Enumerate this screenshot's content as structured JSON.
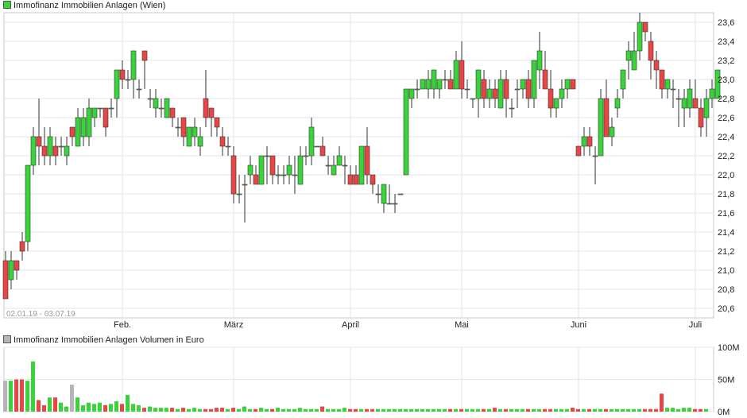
{
  "price_legend": "Immofinanz Immobilien Anlagen (Wien)",
  "volume_legend": "Immofinanz Immobilien Anlagen Volumen in Euro",
  "date_range": "02.01.19 - 03.07.19",
  "colors": {
    "up": "#39d439",
    "down": "#e84545",
    "neutral": "#b5b5b5",
    "grid": "#e6e6e6",
    "frame": "#c8c8c8"
  },
  "chart_data": [
    {
      "type": "candlestick",
      "title": "Immofinanz Immobilien Anlagen (Wien)",
      "ylim": [
        20.5,
        23.7
      ],
      "yticks": [
        "20,6",
        "20,8",
        "21,0",
        "21,2",
        "21,4",
        "21,6",
        "21,8",
        "22,0",
        "22,2",
        "22,4",
        "22,6",
        "22,8",
        "23,0",
        "23,2",
        "23,4",
        "23,6"
      ],
      "xticks": [
        {
          "label": "Feb.",
          "index": 21
        },
        {
          "label": "März",
          "index": 41
        },
        {
          "label": "April",
          "index": 62
        },
        {
          "label": "Mai",
          "index": 82
        },
        {
          "label": "Juni",
          "index": 103
        },
        {
          "label": "Juli",
          "index": 124
        }
      ],
      "candles": [
        [
          21.1,
          20.7,
          21.2,
          20.7
        ],
        [
          20.9,
          21.1,
          21.2,
          20.8
        ],
        [
          21.1,
          21.0,
          21.1,
          20.9
        ],
        [
          21.3,
          21.2,
          21.4,
          21.1
        ],
        [
          21.3,
          22.1,
          22.1,
          21.2
        ],
        [
          22.1,
          22.4,
          22.5,
          22.0
        ],
        [
          22.4,
          22.3,
          22.8,
          22.1
        ],
        [
          22.3,
          22.2,
          22.5,
          22.1
        ],
        [
          22.2,
          22.4,
          22.5,
          22.1
        ],
        [
          22.3,
          22.2,
          22.4,
          22.1
        ],
        [
          22.3,
          22.3,
          22.4,
          22.2
        ],
        [
          22.2,
          22.3,
          22.4,
          22.1
        ],
        [
          22.5,
          22.4,
          22.5,
          22.3
        ],
        [
          22.3,
          22.6,
          22.7,
          22.3
        ],
        [
          22.4,
          22.6,
          22.7,
          22.3
        ],
        [
          22.4,
          22.7,
          22.8,
          22.3
        ],
        [
          22.6,
          22.7,
          22.7,
          22.5
        ],
        [
          22.7,
          22.7,
          22.7,
          22.6
        ],
        [
          22.7,
          22.5,
          22.7,
          22.4
        ],
        [
          22.7,
          22.7,
          22.8,
          22.6
        ],
        [
          22.8,
          23.1,
          23.1,
          22.6
        ],
        [
          23.1,
          23.0,
          23.2,
          22.9
        ],
        [
          23.0,
          23.0,
          23.1,
          22.9
        ],
        [
          23.0,
          23.3,
          23.3,
          22.8
        ],
        [
          22.9,
          22.9,
          23.0,
          22.8
        ],
        [
          23.3,
          23.2,
          23.3,
          22.9
        ],
        [
          22.8,
          22.8,
          22.9,
          22.7
        ],
        [
          22.7,
          22.8,
          22.9,
          22.6
        ],
        [
          22.7,
          22.7,
          22.8,
          22.6
        ],
        [
          22.6,
          22.8,
          22.8,
          22.6
        ],
        [
          22.7,
          22.6,
          22.7,
          22.5
        ],
        [
          22.5,
          22.5,
          22.6,
          22.4
        ],
        [
          22.6,
          22.4,
          22.6,
          22.3
        ],
        [
          22.3,
          22.5,
          22.5,
          22.3
        ],
        [
          22.4,
          22.5,
          22.6,
          22.3
        ],
        [
          22.3,
          22.4,
          22.5,
          22.2
        ],
        [
          22.8,
          22.6,
          23.1,
          22.5
        ],
        [
          22.7,
          22.6,
          22.7,
          22.4
        ],
        [
          22.6,
          22.5,
          22.6,
          22.4
        ],
        [
          22.4,
          22.3,
          22.5,
          22.2
        ],
        [
          22.3,
          22.3,
          22.4,
          22.2
        ],
        [
          22.2,
          21.8,
          22.3,
          21.7
        ],
        [
          21.8,
          21.8,
          22.0,
          21.7
        ],
        [
          21.9,
          21.9,
          22.0,
          21.5
        ],
        [
          22.0,
          22.1,
          22.2,
          21.9
        ],
        [
          22.0,
          21.9,
          22.1,
          21.9
        ],
        [
          21.9,
          22.2,
          22.2,
          21.9
        ],
        [
          22.2,
          22.2,
          22.3,
          21.9
        ],
        [
          22.2,
          22.0,
          22.2,
          21.9
        ],
        [
          22.0,
          22.0,
          22.1,
          21.9
        ],
        [
          22.0,
          22.0,
          22.1,
          21.9
        ],
        [
          22.0,
          22.1,
          22.2,
          21.9
        ],
        [
          22.0,
          22.0,
          22.2,
          21.8
        ],
        [
          21.9,
          22.2,
          22.3,
          21.9
        ],
        [
          22.2,
          22.2,
          22.3,
          22.1
        ],
        [
          22.2,
          22.5,
          22.6,
          22.1
        ],
        [
          22.3,
          22.3,
          22.3,
          22.3
        ],
        [
          22.3,
          22.2,
          22.4,
          22.2
        ],
        [
          22.1,
          22.1,
          22.2,
          22.0
        ],
        [
          22.0,
          22.1,
          22.2,
          22.0
        ],
        [
          22.1,
          22.2,
          22.3,
          22.1
        ],
        [
          22.1,
          22.1,
          22.2,
          21.9
        ],
        [
          22.0,
          21.9,
          22.1,
          21.9
        ],
        [
          22.0,
          21.9,
          22.1,
          21.9
        ],
        [
          21.9,
          22.3,
          22.3,
          21.9
        ],
        [
          22.3,
          22.0,
          22.5,
          21.9
        ],
        [
          22.0,
          21.9,
          22.0,
          21.8
        ],
        [
          21.8,
          21.8,
          21.9,
          21.7
        ],
        [
          21.7,
          21.9,
          21.9,
          21.6
        ],
        [
          21.7,
          21.7,
          21.9,
          21.7
        ],
        [
          21.7,
          21.7,
          21.8,
          21.6
        ],
        [
          21.8,
          21.8,
          21.8,
          21.8
        ],
        [
          22.0,
          22.9,
          22.9,
          22.0
        ],
        [
          22.8,
          22.9,
          22.9,
          22.7
        ],
        [
          22.9,
          22.9,
          23.0,
          22.8
        ],
        [
          22.9,
          23.0,
          23.0,
          22.9
        ],
        [
          22.9,
          23.0,
          23.1,
          22.8
        ],
        [
          22.9,
          23.1,
          23.1,
          22.8
        ],
        [
          22.9,
          23.0,
          23.0,
          22.8
        ],
        [
          23.0,
          23.0,
          23.1,
          22.9
        ],
        [
          23.0,
          22.9,
          23.1,
          22.9
        ],
        [
          22.9,
          23.2,
          23.3,
          22.9
        ],
        [
          23.2,
          22.9,
          23.4,
          22.8
        ],
        [
          22.9,
          22.9,
          23.0,
          22.8
        ],
        [
          22.8,
          22.8,
          22.8,
          22.7
        ],
        [
          22.8,
          23.1,
          23.1,
          22.6
        ],
        [
          23.0,
          22.8,
          23.1,
          22.7
        ],
        [
          22.8,
          22.9,
          23.0,
          22.7
        ],
        [
          22.9,
          22.8,
          23.0,
          22.7
        ],
        [
          22.7,
          23.0,
          23.1,
          22.7
        ],
        [
          23.0,
          22.8,
          23.1,
          22.6
        ],
        [
          22.7,
          22.7,
          22.8,
          22.6
        ],
        [
          22.9,
          22.9,
          23.0,
          22.7
        ],
        [
          22.9,
          23.0,
          23.0,
          22.8
        ],
        [
          23.0,
          22.8,
          23.1,
          22.7
        ],
        [
          22.8,
          23.2,
          23.2,
          22.7
        ],
        [
          23.1,
          23.3,
          23.5,
          22.9
        ],
        [
          23.1,
          22.9,
          23.3,
          22.9
        ],
        [
          22.9,
          22.7,
          23.1,
          22.6
        ],
        [
          22.7,
          22.8,
          22.8,
          22.6
        ],
        [
          22.8,
          22.9,
          23.0,
          22.7
        ],
        [
          22.9,
          23.0,
          23.0,
          22.8
        ],
        [
          23.0,
          22.9,
          23.0,
          22.9
        ],
        [
          22.3,
          22.2,
          22.3,
          22.2
        ],
        [
          22.3,
          22.4,
          22.5,
          22.2
        ],
        [
          22.4,
          22.3,
          22.5,
          22.2
        ],
        [
          22.2,
          22.2,
          22.3,
          21.9
        ],
        [
          22.2,
          22.8,
          22.9,
          22.2
        ],
        [
          22.8,
          22.4,
          23.0,
          22.4
        ],
        [
          22.4,
          22.5,
          22.6,
          22.3
        ],
        [
          22.7,
          22.8,
          22.9,
          22.6
        ],
        [
          22.9,
          23.1,
          23.1,
          22.8
        ],
        [
          23.2,
          23.3,
          23.4,
          23.0
        ],
        [
          23.1,
          23.3,
          23.5,
          23.1
        ],
        [
          23.3,
          23.6,
          23.7,
          23.2
        ],
        [
          23.6,
          23.5,
          23.6,
          23.4
        ],
        [
          23.4,
          23.2,
          23.5,
          23.0
        ],
        [
          23.2,
          23.1,
          23.3,
          22.9
        ],
        [
          23.1,
          22.9,
          23.1,
          22.8
        ],
        [
          22.9,
          23.0,
          23.0,
          22.8
        ],
        [
          22.9,
          22.9,
          23.0,
          22.7
        ],
        [
          22.8,
          22.8,
          22.9,
          22.5
        ],
        [
          22.7,
          22.8,
          22.9,
          22.5
        ],
        [
          22.7,
          22.9,
          23.0,
          22.6
        ],
        [
          22.8,
          22.7,
          23.0,
          22.7
        ],
        [
          22.7,
          22.5,
          22.8,
          22.4
        ],
        [
          22.6,
          22.8,
          22.9,
          22.4
        ],
        [
          22.8,
          22.9,
          23.0,
          22.7
        ],
        [
          22.8,
          23.1,
          23.1,
          22.8
        ]
      ]
    },
    {
      "type": "bar",
      "title": "Immofinanz Immobilien Anlagen Volumen in Euro",
      "ylim": [
        0,
        100
      ],
      "yticks": [
        "0M",
        "50M",
        "100M"
      ],
      "values": [
        48,
        48,
        50,
        50,
        48,
        78,
        18,
        10,
        22,
        22,
        14,
        8,
        42,
        22,
        10,
        14,
        12,
        14,
        10,
        12,
        16,
        12,
        26,
        12,
        10,
        6,
        8,
        6,
        6,
        6,
        6,
        4,
        6,
        4,
        6,
        4,
        4,
        4,
        6,
        6,
        4,
        6,
        4,
        8,
        4,
        4,
        6,
        4,
        4,
        6,
        4,
        4,
        4,
        6,
        4,
        4,
        4,
        8,
        4,
        4,
        4,
        6,
        4,
        4,
        4,
        4,
        4,
        4,
        4,
        4,
        4,
        4,
        4,
        4,
        4,
        4,
        4,
        4,
        4,
        4,
        4,
        4,
        4,
        4,
        4,
        4,
        4,
        4,
        6,
        4,
        4,
        4,
        4,
        4,
        4,
        4,
        4,
        4,
        4,
        4,
        4,
        4,
        6,
        4,
        4,
        4,
        4,
        4,
        4,
        4,
        4,
        4,
        4,
        4,
        4,
        4,
        4,
        4,
        28,
        6,
        6,
        4,
        6,
        6,
        4,
        4,
        4
      ],
      "neutral_bars": [
        0,
        12
      ]
    }
  ]
}
